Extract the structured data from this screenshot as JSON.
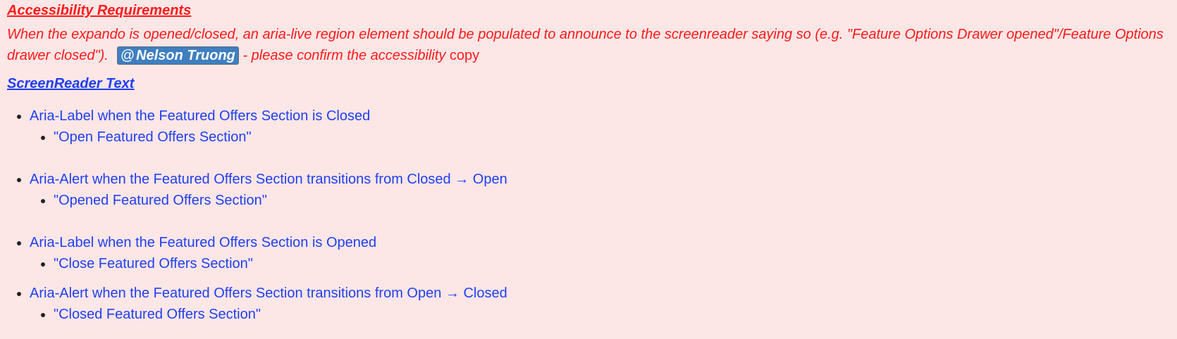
{
  "accessibility": {
    "heading": "Accessibility Requirements",
    "paragraph_text": "When the expando is opened/closed, an aria-live region element should be populated to announce to the screenreader saying so (e.g. \"Feature Options Drawer opened\"/Feature Options drawer closed\").",
    "mention_at": "@",
    "mention_name": "Nelson Truong",
    "after_mention": " - please confirm the accessibility",
    "tail_word": " copy"
  },
  "screenreader": {
    "heading": "ScreenReader Text",
    "items": [
      {
        "label": "Aria-Label when the Featured Offers Section is Closed",
        "sub": "\"Open Featured Offers Section\""
      },
      {
        "label": "Aria-Alert when the Featured Offers Section transitions from Closed → Open",
        "sub": "\"Opened Featured Offers Section\""
      },
      {
        "label": "Aria-Label when the Featured Offers Section is Opened",
        "sub": "\"Close Featured Offers Section\""
      },
      {
        "label": "Aria-Alert when the Featured Offers Section transitions from Open → Closed",
        "sub": "\"Closed Featured Offers Section\""
      }
    ]
  },
  "colors": {
    "background": "#fde6e6",
    "requirement_red": "#ff1a1a",
    "text_blue": "#1f3ff0",
    "mention_bg": "#3f7fc0"
  }
}
